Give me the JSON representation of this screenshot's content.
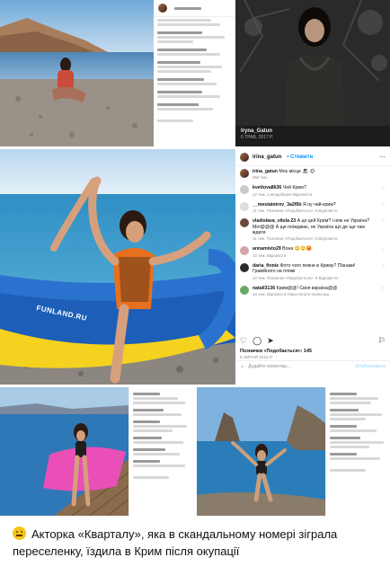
{
  "top_right_caption": {
    "name": "Iryna_Gatun",
    "sub": "6 ТРАВ. 2017 Р."
  },
  "main_post": {
    "username": "irina_gatun",
    "follow_label": "• Стежити",
    "watermark": "FUNLAND.RU",
    "comments": [
      {
        "user": "irina_gatun",
        "text": "Моє місце 🏖 ☀",
        "meta": "392 тиж."
      },
      {
        "user": "kvetlova8636",
        "text": "Чей Крим?",
        "meta": "12 тиж.   1 вподобання   Відповісти"
      },
      {
        "user": "__mestatetrov_3a2f6b",
        "text": "Я ну чий-крим?",
        "meta": "11 тиж.   Позначки «Подобається»: 6   Відповісти"
      },
      {
        "user": "vladislava_vitsla 23",
        "text": "А це цей Крим? і ніяк не Україна? Міл@@@ А ще поїжджає, не Україна що де ще там ждати",
        "meta": "11 тиж.   Позначки «Подобається»: 6   Відповісти"
      },
      {
        "user": "annamisto29",
        "text": "Вона 🙄🙄😡",
        "meta": "10 тиж.   Відповісти"
      },
      {
        "user": "daria_finnie",
        "text": "Фото чого повне в Криму? Пізнаки! Гравійного на пляжі",
        "meta": "10 тиж.   Позначки «Подобається»: 6   Відповісти"
      },
      {
        "user": "natali3136",
        "text": "Крим@@! Своя вкраїна@@",
        "meta": "10 тиж.   Відповісти   Переглянути переклад"
      }
    ],
    "likes": "Позначки «Подобається»: 145",
    "date": "6 ЛИПНЯ 2015 Р.",
    "add_comment": "Додайте коментар...",
    "publish": "Опублікувати"
  },
  "caption": {
    "text": "Акторка «Кварталу», яка в скандальному номері зіграла переселенку, їздила в Крим після окупації"
  },
  "colors": {
    "accent": "#0095f6",
    "meta": "#8e8e8e",
    "emoji": "#f5c518"
  }
}
